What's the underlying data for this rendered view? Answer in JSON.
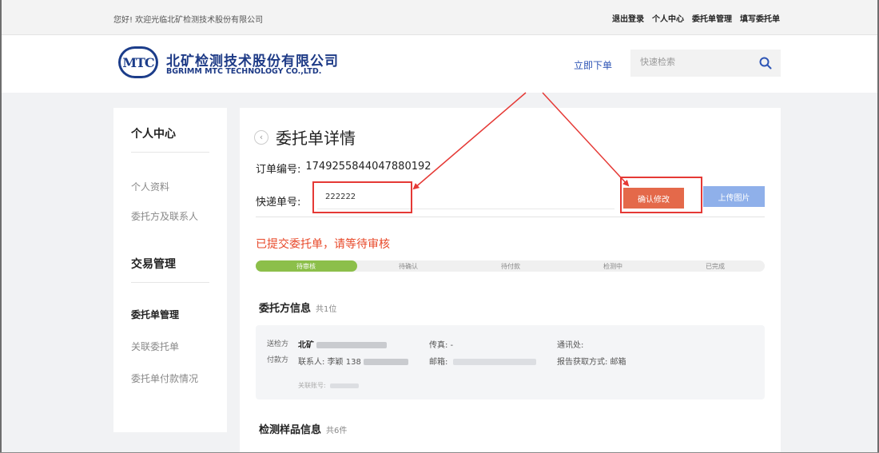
{
  "topbar": {
    "welcome": "您好! 欢迎光临北矿检测技术股份有限公司",
    "links": [
      "退出登录",
      "个人中心",
      "委托单管理",
      "填写委托单"
    ]
  },
  "header": {
    "logo_text": "MTC",
    "company_cn": "北矿检测技术股份有限公司",
    "company_en": "BGRIMM MTC TECHNOLOGY CO.,LTD.",
    "order_now": "立即下单",
    "search_placeholder": "快速检索"
  },
  "sidebar": {
    "section1": "个人中心",
    "section1_items": [
      "个人资料",
      "委托方及联系人"
    ],
    "section2": "交易管理",
    "section2_items": [
      "委托单管理",
      "关联委托单",
      "委托单付款情况"
    ],
    "active_item": "委托单管理"
  },
  "main": {
    "back_glyph": "‹",
    "title": "委托单详情",
    "order_label": "订单编号:",
    "order_number": "1749255844047880192",
    "tracking_label": "快递单号:",
    "tracking_value": "222222",
    "confirm_button": "确认修改",
    "upload_button": "上传图片",
    "status_message": "已提交委托单，请等待审核",
    "progress": {
      "current_step": 1,
      "steps": [
        "待审核",
        "待确认",
        "待付款",
        "检测中",
        "已完成"
      ]
    },
    "client_section": {
      "title": "委托方信息",
      "count": "共1位",
      "tag_sender": "送检方",
      "tag_payer": "付款方",
      "name": "北矿",
      "fax": "传真: -",
      "address": "通讯处:",
      "contact": "联系人: 李颖 138",
      "email": "邮箱: ",
      "report_method": "报告获取方式: 邮箱",
      "linked_account": "关联账号: "
    },
    "sample_section": {
      "title": "检测样品信息",
      "count": "共6件"
    }
  },
  "annotation": {
    "highlight_color": "#e53935"
  }
}
